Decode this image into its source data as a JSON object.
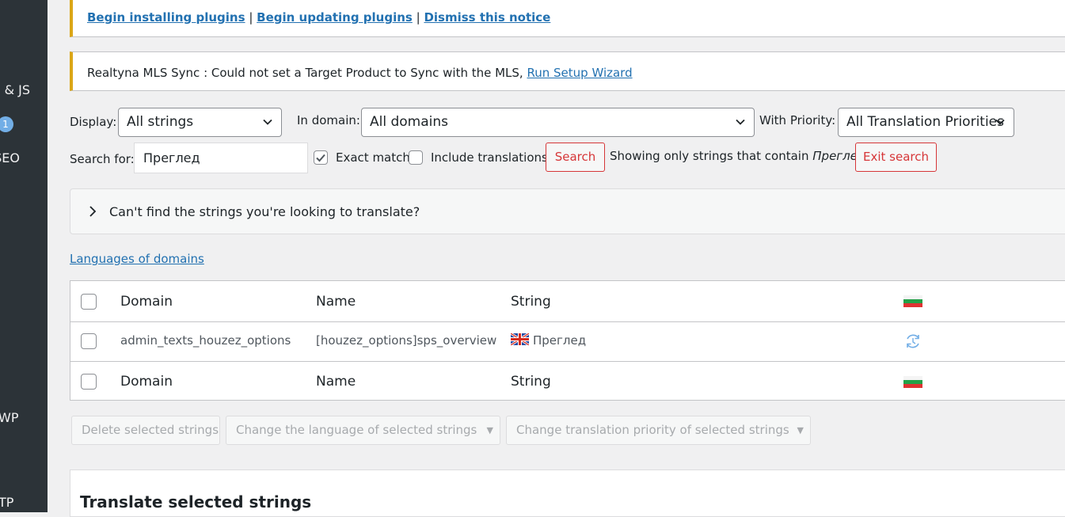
{
  "sidebar": {
    "items": [
      {
        "label": "& JS"
      },
      {
        "label": "SEO"
      },
      {
        "label": "WP"
      },
      {
        "label": "TP"
      }
    ],
    "badge": "1"
  },
  "notices": {
    "plugins": {
      "begin_installing": "Begin installing plugins",
      "begin_updating": "Begin updating plugins",
      "dismiss": "Dismiss this notice",
      "separator": "|"
    },
    "mls": {
      "text": "Realtyna MLS Sync : Could not set a Target Product to Sync with the MLS,",
      "link": "Run Setup Wizard"
    }
  },
  "filters": {
    "display_label": "Display:",
    "display_value": "All strings",
    "domain_label": "In domain:",
    "domain_value": "All domains",
    "priority_label": "With Priority:",
    "priority_value": "All Translation Priorities",
    "search_label": "Search for:",
    "search_value": "Преглед",
    "exact_match_label": "Exact match",
    "exact_match_checked": true,
    "include_translations_label": "Include translations",
    "include_translations_checked": false,
    "search_button": "Search",
    "showing_text": "Showing only strings that contain",
    "showing_term": "Преглед",
    "exit_search_button": "Exit search"
  },
  "panel": {
    "text": "Can't find the strings you're looking to translate?"
  },
  "languages_link": "Languages of domains",
  "table": {
    "headers": {
      "domain": "Domain",
      "name": "Name",
      "string": "String"
    },
    "rows": [
      {
        "domain": "admin_texts_houzez_options",
        "name": "[houzez_options]sps_overview",
        "string": "Преглед"
      }
    ],
    "footers": {
      "domain": "Domain",
      "name": "Name",
      "string": "String"
    }
  },
  "bulk_actions": {
    "delete": "Delete selected strings",
    "change_language": "Change the language of selected strings",
    "change_priority": "Change translation priority of selected strings"
  },
  "translate_box": {
    "title": "Translate selected strings"
  },
  "colors": {
    "accent": "#2271b1",
    "notice_warning": "#dba617",
    "danger": "#d63638",
    "sidebar": "#2c3338"
  }
}
